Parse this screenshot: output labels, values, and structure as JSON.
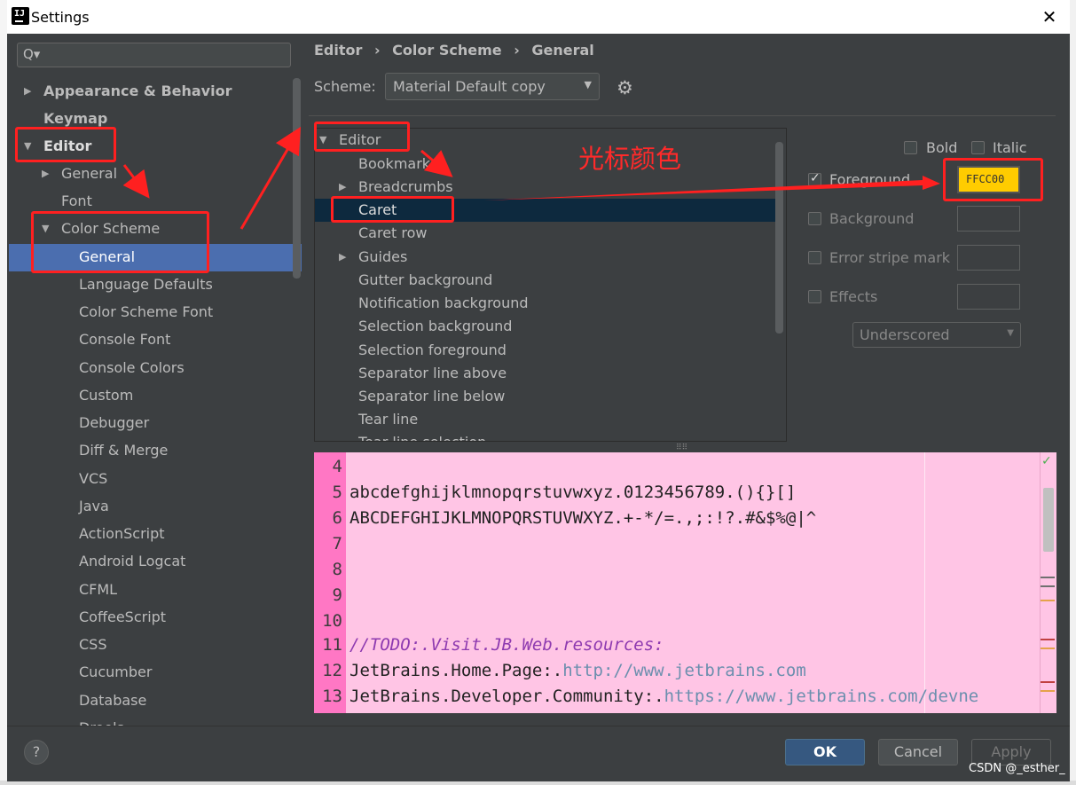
{
  "window": {
    "title": "Settings",
    "app_icon_text": "IJ",
    "close_symbol": "✕"
  },
  "sidebar": {
    "search_icon": "Q▾",
    "items": [
      {
        "label": "Appearance & Behavior",
        "arrow": "▶"
      },
      {
        "label": "Keymap"
      },
      {
        "label": "Editor",
        "arrow": "▼"
      },
      {
        "label": "General",
        "arrow": "▶"
      },
      {
        "label": "Font"
      },
      {
        "label": "Color Scheme",
        "arrow": "▼"
      },
      {
        "label": "General"
      },
      {
        "label": "Language Defaults"
      },
      {
        "label": "Color Scheme Font"
      },
      {
        "label": "Console Font"
      },
      {
        "label": "Console Colors"
      },
      {
        "label": "Custom"
      },
      {
        "label": "Debugger"
      },
      {
        "label": "Diff & Merge"
      },
      {
        "label": "VCS"
      },
      {
        "label": "Java"
      },
      {
        "label": "ActionScript"
      },
      {
        "label": "Android Logcat"
      },
      {
        "label": "CFML"
      },
      {
        "label": "CoffeeScript"
      },
      {
        "label": "CSS"
      },
      {
        "label": "Cucumber"
      },
      {
        "label": "Database"
      },
      {
        "label": "Drools"
      }
    ]
  },
  "breadcrumb": [
    "Editor",
    "›",
    "Color Scheme",
    "›",
    "General"
  ],
  "scheme": {
    "label": "Scheme:",
    "value": "Material Default copy",
    "dropdown_arrow": "▼",
    "gear_icon": "⚙"
  },
  "tree": {
    "items": [
      {
        "label": "Editor",
        "arrow": "▼"
      },
      {
        "label": "Bookmarks"
      },
      {
        "label": "Breadcrumbs",
        "arrow": "▶"
      },
      {
        "label": "Caret"
      },
      {
        "label": "Caret row"
      },
      {
        "label": "Guides",
        "arrow": "▶"
      },
      {
        "label": "Gutter background"
      },
      {
        "label": "Notification background"
      },
      {
        "label": "Selection background"
      },
      {
        "label": "Selection foreground"
      },
      {
        "label": "Separator line above"
      },
      {
        "label": "Separator line below"
      },
      {
        "label": "Tear line"
      },
      {
        "label": "Tear line selection"
      }
    ],
    "grip": "⠿⠿"
  },
  "annotation": {
    "text": "光标颜色",
    "color": "#ff2020"
  },
  "attributes": {
    "bold": {
      "label": "Bold",
      "checked": false
    },
    "italic": {
      "label": "Italic",
      "checked": false
    },
    "foreground": {
      "label": "Foreground",
      "checked": true,
      "value": "FFCC00",
      "color": "#ffcc00"
    },
    "background": {
      "label": "Background",
      "checked": false
    },
    "error_stripe": {
      "label": "Error stripe mark",
      "checked": false
    },
    "effects": {
      "label": "Effects",
      "checked": false
    },
    "effect_type": "Underscored",
    "effect_arrow": "▼"
  },
  "preview": {
    "background": "#ffc5e5",
    "gutter_color": "#ff77c4",
    "lines": [
      {
        "num": "4",
        "text": ""
      },
      {
        "num": "5",
        "text": "abcdefghijklmnopqrstuvwxyz.0123456789.(){}[]"
      },
      {
        "num": "6",
        "text": "ABCDEFGHIJKLMNOPQRSTUVWXYZ.+-*/=.,;:!?.#&$%@|^"
      },
      {
        "num": "7",
        "text": ""
      },
      {
        "num": "8",
        "text": ""
      },
      {
        "num": "9",
        "text": ""
      },
      {
        "num": "10",
        "text": ""
      },
      {
        "num": "11",
        "text": "//TODO:.Visit.JB.Web.resources:"
      },
      {
        "num": "12",
        "text_prefix": "JetBrains.Home.Page:.",
        "url": "http://www.jetbrains.com"
      },
      {
        "num": "13",
        "text_prefix": "JetBrains.Developer.Community:.",
        "url": "https://www.jetbrains.com/devne"
      }
    ],
    "check_icon": "✓"
  },
  "buttons": {
    "help": "?",
    "ok": "OK",
    "cancel": "Cancel",
    "apply": "Apply"
  },
  "watermark": "CSDN @_esther_"
}
